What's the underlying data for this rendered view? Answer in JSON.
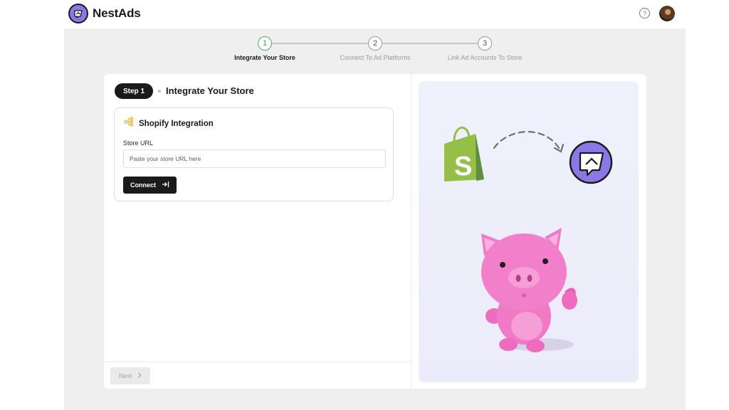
{
  "app": {
    "name": "NestAds"
  },
  "header": {
    "help_icon": "question-circle-icon",
    "avatar": "user-avatar"
  },
  "stepper": {
    "steps": [
      {
        "number": "1",
        "label": "Integrate Your Store",
        "active": true
      },
      {
        "number": "2",
        "label": "Connect To Ad Platforms",
        "active": false
      },
      {
        "number": "3",
        "label": "Link Ad Accounts To Store",
        "active": false
      }
    ],
    "active_color": "#4caf6a"
  },
  "main": {
    "step_pill": "Step 1",
    "title": "Integrate Your Store",
    "integration": {
      "title": "Shopify Integration",
      "icon": "integration-nodes-icon",
      "field_label": "Store URL",
      "url_placeholder": "Paste your store URL here",
      "url_value": "",
      "connect_label": "Connect"
    },
    "next_label": "Next"
  },
  "illustration": {
    "items": [
      "shopify-bag-icon",
      "dashed-arrow",
      "nestads-logo-icon",
      "pink-pig-mascot"
    ]
  },
  "colors": {
    "brand_purple": "#8b78e6",
    "shopify_green": "#95bf47",
    "dark": "#1a1a1a",
    "pig_pink": "#f06fc0"
  }
}
